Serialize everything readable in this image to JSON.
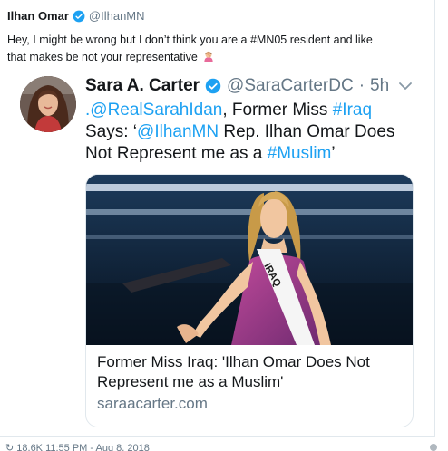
{
  "tweet": {
    "author_name": "Ilhan Omar",
    "author_handle": "@IlhanMN",
    "text_line1": "Hey, I might be wrong but I don’t think you are a #MN05 resident and like",
    "text_line2": "that makes be not your representative",
    "emoji": "woman-facepalming-emoji"
  },
  "quoted": {
    "author_name": "Sara A. Carter",
    "author_handle": "@SaraCarterDC",
    "separator": "·",
    "time": "5h",
    "text_part1_link": ".@RealSarahIdan",
    "text_part2": ", Former Miss ",
    "text_part3_link": "#Iraq",
    "text_part4": "Says: ‘",
    "text_part5_link": "@IlhanMN",
    "text_part6": " Rep. Ilhan Omar Does Not Represent me as a ",
    "text_part7_link": "#Muslim",
    "text_part8": "’",
    "card": {
      "sash_text": "IRAQ",
      "title": "Former Miss Iraq: 'Ilhan Omar Does Not Represent me as a Muslim'",
      "domain": "saraacarter.com"
    }
  },
  "footer": {
    "text": "↻ 18.6K  11:55 PM - Aug 8, 2018"
  },
  "colors": {
    "link": "#1da1f2",
    "verified": "#1da1f2",
    "muted": "#657786"
  }
}
